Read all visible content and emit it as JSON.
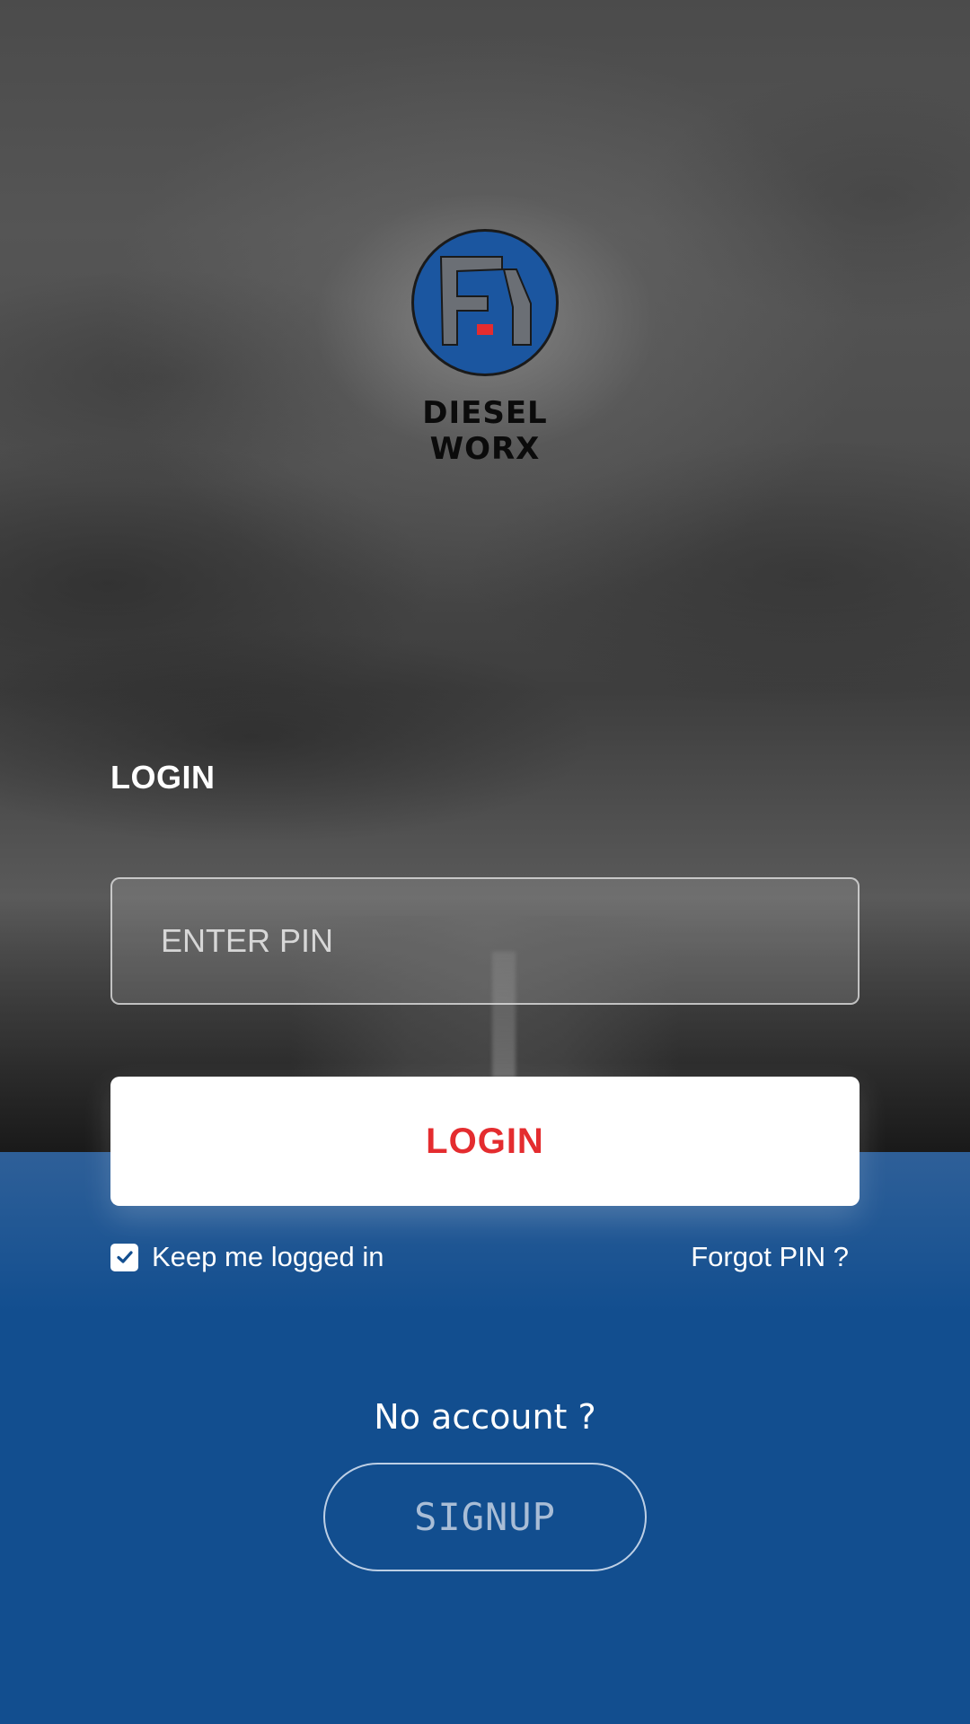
{
  "brand": {
    "name": "DIESEL WORX",
    "logo_icon": "fd-logo-icon",
    "colors": {
      "logo_blue": "#1b56a0",
      "logo_accent": "#e42c2f"
    }
  },
  "login": {
    "heading": "LOGIN",
    "pin_field": {
      "placeholder": "ENTER PIN",
      "value": ""
    },
    "submit_label": "LOGIN",
    "keep_logged_in": {
      "label": "Keep me logged in",
      "checked": true
    },
    "forgot_label": "Forgot PIN ?"
  },
  "signup": {
    "prompt": "No account ?",
    "button_label": "SIGNUP"
  },
  "theme": {
    "primary_blue": "#124e8f",
    "button_text_red": "#e42c2f",
    "text_white": "#ffffff"
  }
}
